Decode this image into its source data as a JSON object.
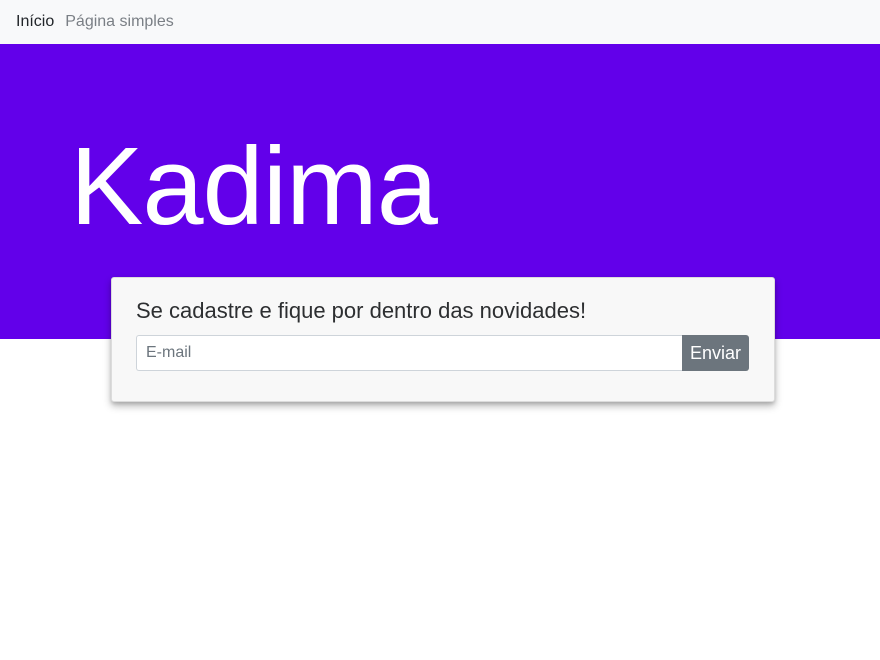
{
  "navbar": {
    "items": [
      {
        "label": "Início"
      },
      {
        "label": "Página simples"
      }
    ]
  },
  "hero": {
    "title": "Kadima",
    "background_color": "#6200ea"
  },
  "signup": {
    "heading": "Se cadastre e fique por dentro das novidades!",
    "email_placeholder": "E-mail",
    "email_value": "",
    "submit_label": "Enviar"
  }
}
